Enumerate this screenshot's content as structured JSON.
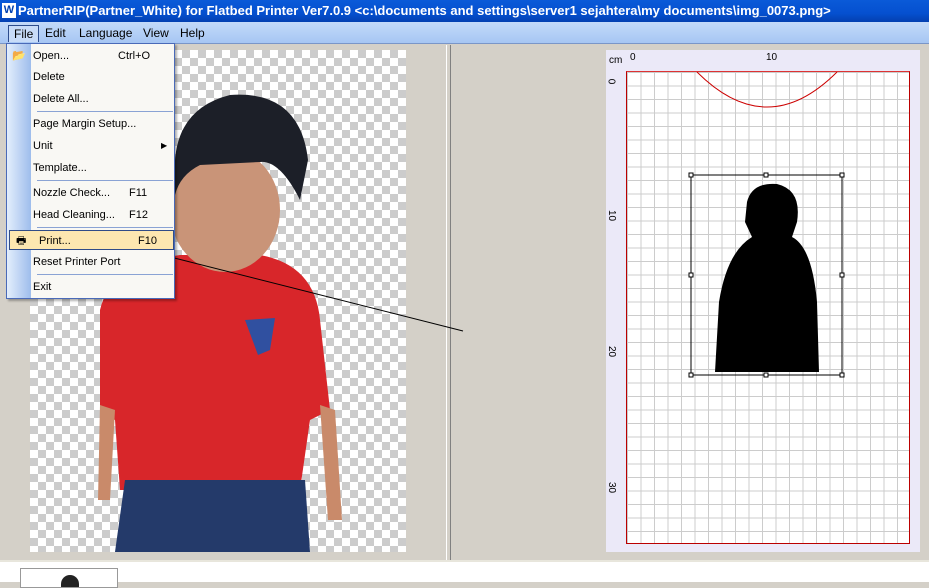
{
  "window": {
    "title": "PartnerRIP(Partner_White) for Flatbed Printer Ver7.0.9 <c:\\documents and settings\\server1 sejahtera\\my documents\\img_0073.png>",
    "icon": "app-icon"
  },
  "menubar": [
    {
      "label": "File"
    },
    {
      "label": "Edit"
    },
    {
      "label": "Language"
    },
    {
      "label": "View"
    },
    {
      "label": "Help"
    }
  ],
  "file_menu": [
    {
      "label": "Open...",
      "shortcut": "Ctrl+O",
      "icon": "folder-open-icon"
    },
    {
      "label": "Delete",
      "shortcut": ""
    },
    {
      "label": "Delete All...",
      "shortcut": ""
    },
    {
      "label": "Page Margin Setup...",
      "shortcut": ""
    },
    {
      "label": "Unit",
      "shortcut": "",
      "submenu": true
    },
    {
      "label": "Template...",
      "shortcut": ""
    },
    {
      "label": "Nozzle Check...",
      "shortcut": "F11"
    },
    {
      "label": "Head Cleaning...",
      "shortcut": "F12"
    },
    {
      "label": "Print...",
      "shortcut": "F10",
      "icon": "printer-icon",
      "highlighted": true
    },
    {
      "label": "Reset Printer Port",
      "shortcut": ""
    },
    {
      "label": "Exit",
      "shortcut": ""
    }
  ],
  "ruler": {
    "unit": "cm",
    "h_labels": [
      "0",
      "10"
    ],
    "v_labels": [
      "0",
      "10",
      "20",
      "30"
    ]
  },
  "colors": {
    "title_bar": "#0550d0",
    "menu_bar": "#b4cff5",
    "highlight": "#fde7b0",
    "page_border": "#bb0000"
  }
}
